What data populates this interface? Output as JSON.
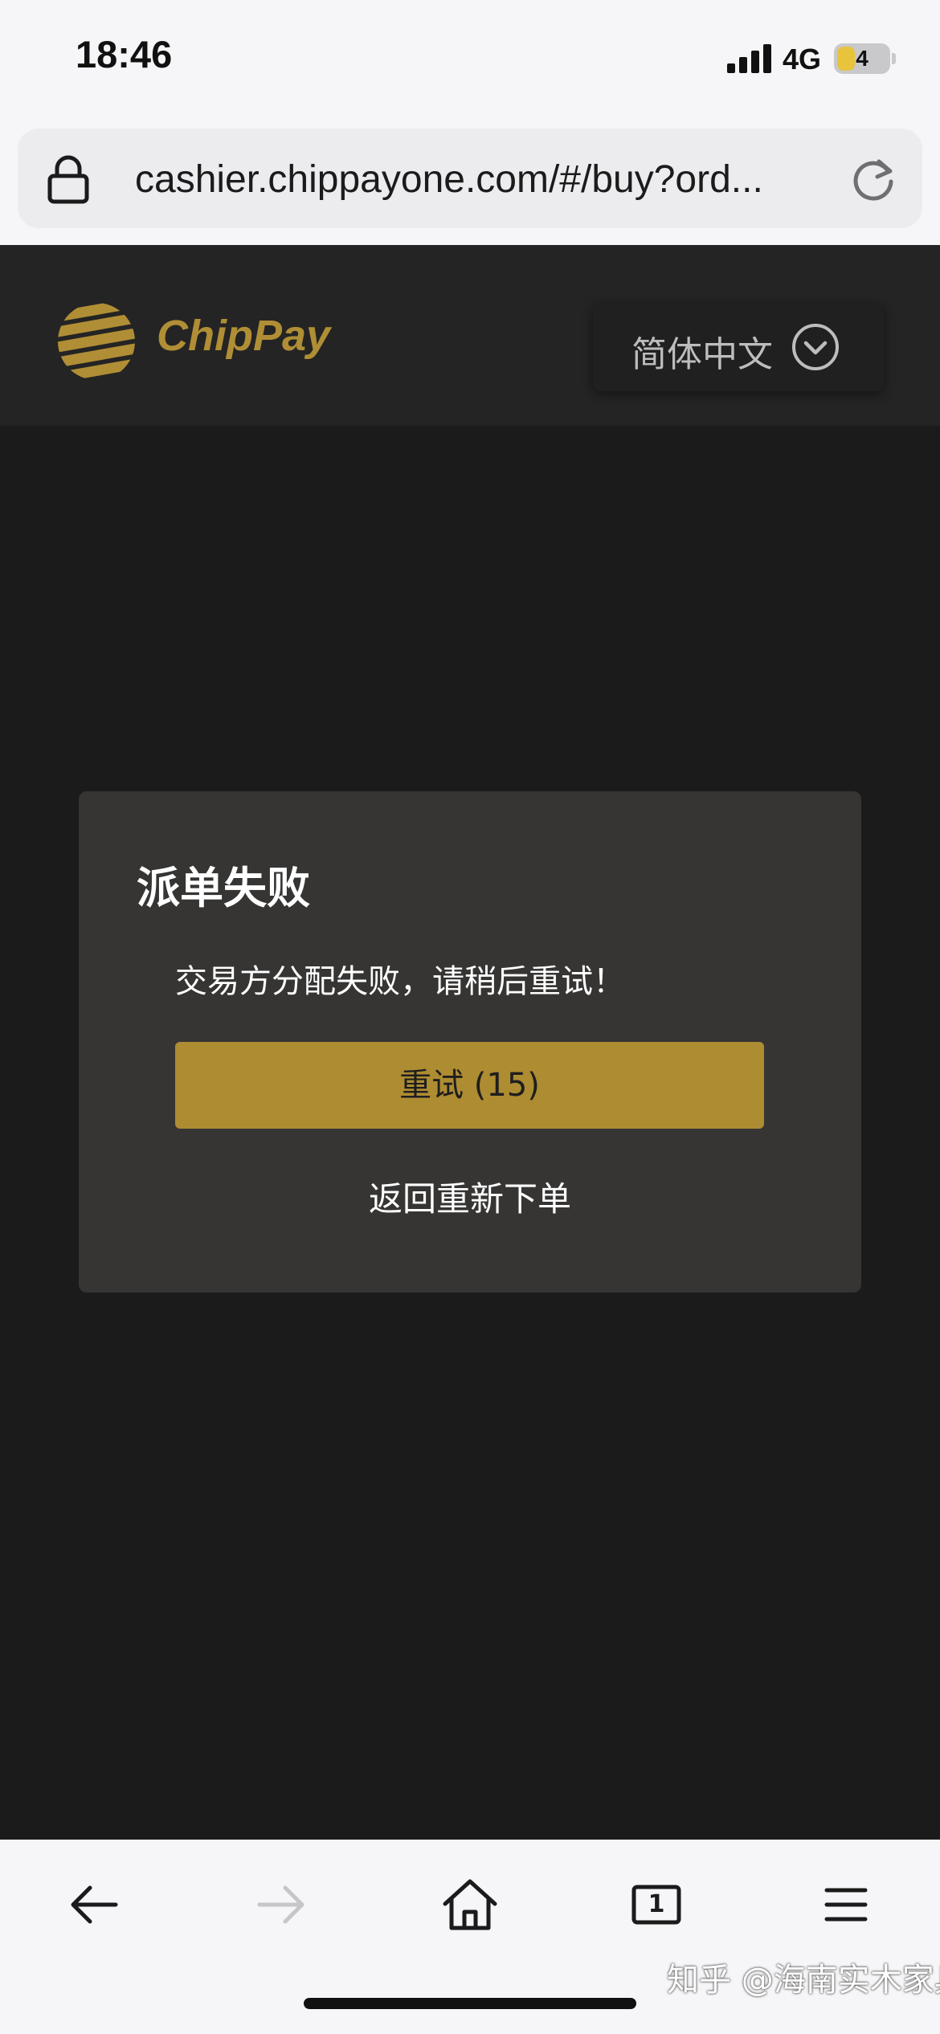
{
  "status_bar": {
    "time": "18:46",
    "network": "4G",
    "battery_level": "4",
    "icons": [
      "signal-icon",
      "battery-icon"
    ]
  },
  "browser": {
    "url": "cashier.chippayone.com/#/buy?ord...",
    "icons": [
      "lock-icon",
      "reload-icon"
    ]
  },
  "header": {
    "logo_text": "ChipPay",
    "language": "简体中文",
    "icons": [
      "logo-icon",
      "chevron-down-icon"
    ]
  },
  "dialog": {
    "title": "派单失败",
    "message": "交易方分配失败，请稍后重试！",
    "retry_button": "重试 (15)",
    "back_link": "返回重新下单"
  },
  "toolbar": {
    "tab_count": "1",
    "icons": [
      "back-arrow-icon",
      "forward-arrow-icon",
      "home-icon",
      "tabs-icon",
      "menu-icon"
    ]
  },
  "watermark": "知乎 @海南实木家具",
  "colors": {
    "brand_gold": "#b08e35",
    "button_gold": "#ad8c32",
    "page_background": "#1b1b1b",
    "header_background": "#242424",
    "dialog_background": "#363534"
  }
}
